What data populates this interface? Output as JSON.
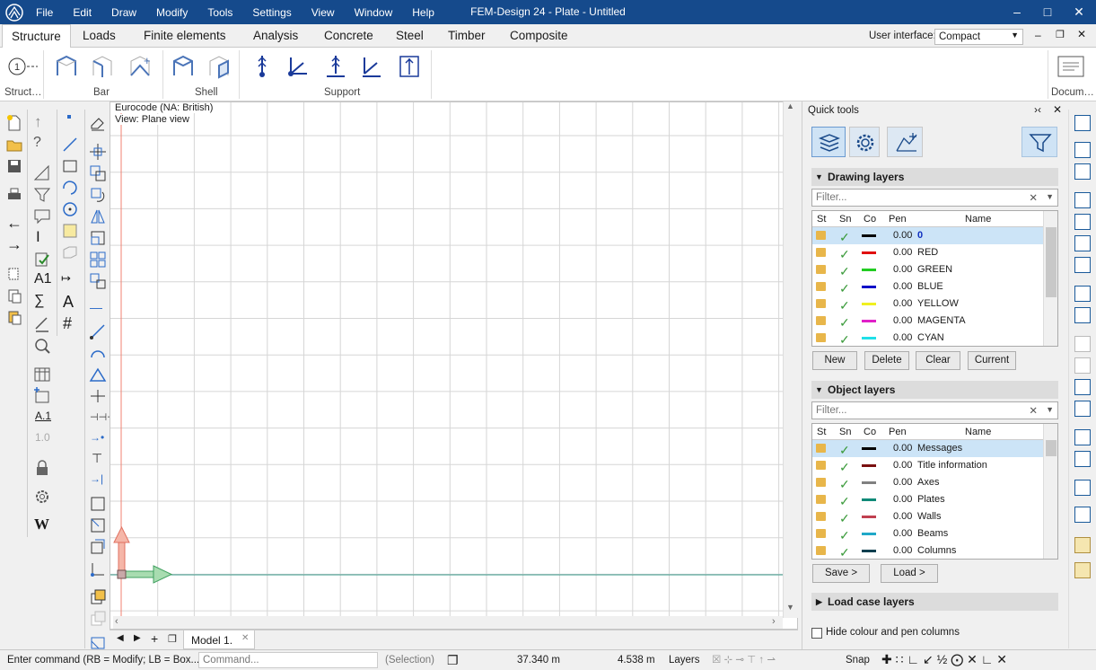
{
  "titlebar": {
    "title": "FEM-Design 24 - Plate - Untitled",
    "menu": [
      "File",
      "Edit",
      "Draw",
      "Modify",
      "Tools",
      "Settings",
      "View",
      "Window",
      "Help"
    ]
  },
  "ribbon": {
    "tabs": [
      "Structure",
      "Loads",
      "Finite elements",
      "Analysis",
      "Concrete",
      "Steel",
      "Timber",
      "Composite"
    ],
    "active_tab": "Structure",
    "ui_label": "User interface:",
    "ui_value": "Compact",
    "groups": [
      "Struct…",
      "Bar",
      "Shell",
      "Support",
      "Docum…"
    ]
  },
  "canvas": {
    "code": "Eurocode (NA: British)",
    "view": "View: Plane view"
  },
  "model_tab": "Model 1.",
  "quick_tools": {
    "title": "Quick tools",
    "drawing_layers": {
      "title": "Drawing layers",
      "filter": "Filter...",
      "columns": [
        "St",
        "Sn",
        "Co",
        "Pen",
        "Name"
      ],
      "rows": [
        {
          "pen": "0.00",
          "name": "0",
          "color": "#000000"
        },
        {
          "pen": "0.00",
          "name": "RED",
          "color": "#e01010"
        },
        {
          "pen": "0.00",
          "name": "GREEN",
          "color": "#22cc22"
        },
        {
          "pen": "0.00",
          "name": "BLUE",
          "color": "#1010c8"
        },
        {
          "pen": "0.00",
          "name": "YELLOW",
          "color": "#f0f020"
        },
        {
          "pen": "0.00",
          "name": "MAGENTA",
          "color": "#e020c8"
        },
        {
          "pen": "0.00",
          "name": "CYAN",
          "color": "#20e0e8"
        }
      ],
      "buttons": [
        "New",
        "Delete",
        "Clear",
        "Current"
      ]
    },
    "object_layers": {
      "title": "Object layers",
      "filter": "Filter...",
      "columns": [
        "St",
        "Sn",
        "Co",
        "Pen",
        "Name"
      ],
      "rows": [
        {
          "pen": "0.00",
          "name": "Messages",
          "color": "#000000"
        },
        {
          "pen": "0.00",
          "name": "Title information",
          "color": "#7a1010"
        },
        {
          "pen": "0.00",
          "name": "Axes",
          "color": "#808080"
        },
        {
          "pen": "0.00",
          "name": "Plates",
          "color": "#108a78"
        },
        {
          "pen": "0.00",
          "name": "Walls",
          "color": "#c04050"
        },
        {
          "pen": "0.00",
          "name": "Beams",
          "color": "#20a8c8"
        },
        {
          "pen": "0.00",
          "name": "Columns",
          "color": "#104050"
        }
      ],
      "buttons": [
        "Save >",
        "Load >"
      ]
    },
    "load_case_layers": "Load case layers",
    "hide_colour": "Hide colour and pen columns"
  },
  "status": {
    "hint": "Enter command (RB = Modify; LB = Box...",
    "command_placeholder": "Command...",
    "selection": "(Selection)",
    "x": "37.340 m",
    "y": "4.538 m",
    "layers": "Layers",
    "snap": "Snap"
  }
}
